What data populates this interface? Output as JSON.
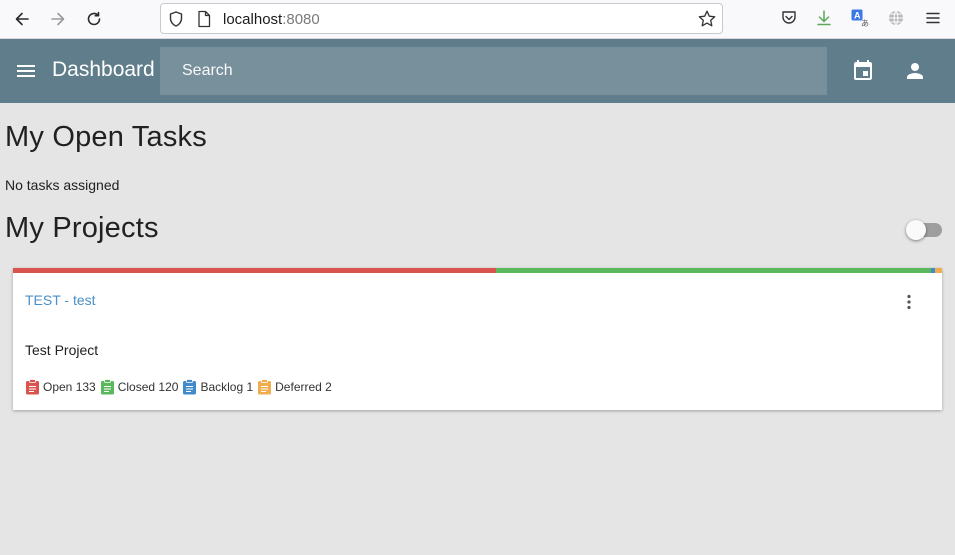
{
  "browser": {
    "url_host": "localhost",
    "url_port": ":8080"
  },
  "header": {
    "title": "Dashboard",
    "search_placeholder": "Search",
    "color": "#607d8b",
    "search_color": "#78909c"
  },
  "tasks": {
    "title": "My Open Tasks",
    "empty_text": "No tasks assigned"
  },
  "projects": {
    "title": "My Projects",
    "toggle_on": false,
    "items": [
      {
        "name": "TEST - test",
        "description": "Test Project",
        "progress": [
          {
            "status": "Open",
            "count": 133,
            "color": "#d9534f"
          },
          {
            "status": "Closed",
            "count": 120,
            "color": "#5cb85c"
          },
          {
            "status": "Backlog",
            "count": 1,
            "color": "#428bca"
          },
          {
            "status": "Deferred",
            "count": 2,
            "color": "#f0ad4e"
          }
        ],
        "stats": [
          {
            "label": "Open 133",
            "icon": "clipboard-icon",
            "color": "#d9534f"
          },
          {
            "label": "Closed 120",
            "icon": "clipboard-icon",
            "color": "#5cb85c"
          },
          {
            "label": "Backlog 1",
            "icon": "clipboard-icon",
            "color": "#428bca"
          },
          {
            "label": "Deferred 2",
            "icon": "clipboard-icon",
            "color": "#f0ad4e"
          }
        ]
      }
    ]
  }
}
